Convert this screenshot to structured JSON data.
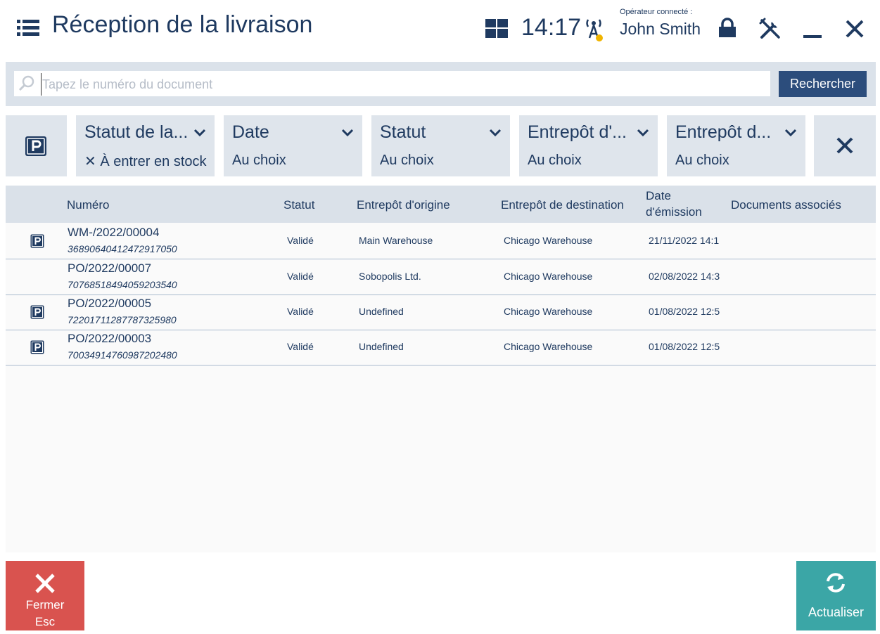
{
  "header": {
    "title": "Réception de la livraison",
    "time": "14:17",
    "operator_caption": "Opérateur connecté :",
    "operator_name": "John Smith"
  },
  "search": {
    "placeholder": "Tapez le numéro du document",
    "value": "",
    "button_label": "Rechercher"
  },
  "filters": [
    {
      "title": "Statut de la...",
      "value": "✕ À entrer en stock"
    },
    {
      "title": "Date",
      "value": "Au choix"
    },
    {
      "title": "Statut",
      "value": "Au choix"
    },
    {
      "title": "Entrepôt d'...",
      "value": "Au choix"
    },
    {
      "title": "Entrepôt d...",
      "value": "Au choix"
    }
  ],
  "table": {
    "columns": {
      "numero": "Numéro",
      "statut": "Statut",
      "origine": "Entrepôt d'origine",
      "destination": "Entrepôt de destination",
      "date_line1": "Date",
      "date_line2": "d'émission",
      "documents": "Documents associés"
    },
    "rows": [
      {
        "parking": true,
        "number": "WM-/2022/00004",
        "code": "36890640412472917050",
        "status": "Validé",
        "origin": "Main Warehouse",
        "destination": "Chicago Warehouse",
        "date": "21/11/2022 14:1",
        "documents": ""
      },
      {
        "parking": false,
        "number": "PO/2022/00007",
        "code": "70768518494059203540",
        "status": "Validé",
        "origin": "Sobopolis Ltd.",
        "destination": "Chicago Warehouse",
        "date": "02/08/2022 14:3",
        "documents": ""
      },
      {
        "parking": true,
        "number": "PO/2022/00005",
        "code": "72201711287787325980",
        "status": "Validé",
        "origin": "Undefined",
        "destination": "Chicago Warehouse",
        "date": "01/08/2022 12:5",
        "documents": ""
      },
      {
        "parking": true,
        "number": "PO/2022/00003",
        "code": "70034914760987202480",
        "status": "Validé",
        "origin": "Undefined",
        "destination": "Chicago Warehouse",
        "date": "01/08/2022 12:5",
        "documents": ""
      }
    ]
  },
  "footer": {
    "close_label": "Fermer",
    "close_shortcut": "Esc",
    "refresh_label": "Actualiser"
  },
  "colors": {
    "primary": "#1f3a60",
    "search_button": "#2c4d7c",
    "close_button": "#d9534f",
    "refresh_button": "#3ba6a6",
    "panel": "#dfe5ec"
  },
  "icons": [
    "menu-icon",
    "layout-grid-icon",
    "connection-icon",
    "lock-icon",
    "tools-icon",
    "minimize-icon",
    "close-icon",
    "search-icon",
    "parking-icon",
    "chevron-down-icon",
    "refresh-icon"
  ]
}
